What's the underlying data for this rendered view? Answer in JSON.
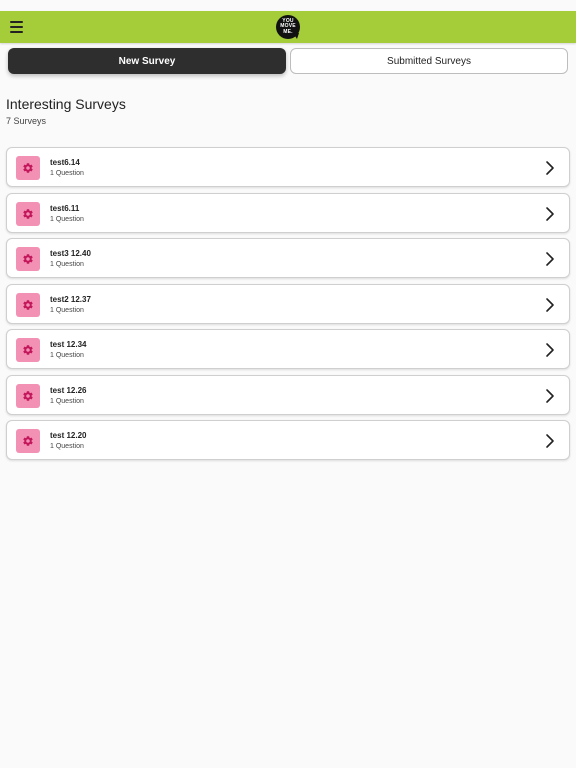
{
  "header": {
    "logo_text": "YOU\nMOVE\nME."
  },
  "segments": {
    "new_label": "New Survey",
    "submitted_label": "Submitted Surveys"
  },
  "section": {
    "title": "Interesting Surveys",
    "count": "7 Surveys"
  },
  "surveys": [
    {
      "title": "test6.14",
      "subtitle": "1 Question"
    },
    {
      "title": "test6.11",
      "subtitle": "1 Question"
    },
    {
      "title": "test3 12.40",
      "subtitle": "1 Question"
    },
    {
      "title": "test2 12.37",
      "subtitle": "1 Question"
    },
    {
      "title": "test 12.34",
      "subtitle": "1 Question"
    },
    {
      "title": "test 12.26",
      "subtitle": "1 Question"
    },
    {
      "title": "test 12.20",
      "subtitle": "1 Question"
    }
  ],
  "colors": {
    "topbar": "#a4cd39",
    "active_segment": "#2e2e2e",
    "survey_icon_bg": "#f391b4",
    "survey_icon_fg": "#c2185b"
  },
  "icons": {
    "menu": "hamburger-menu-icon",
    "survey": "gear-icon",
    "row_action": "chevron-right-icon"
  }
}
